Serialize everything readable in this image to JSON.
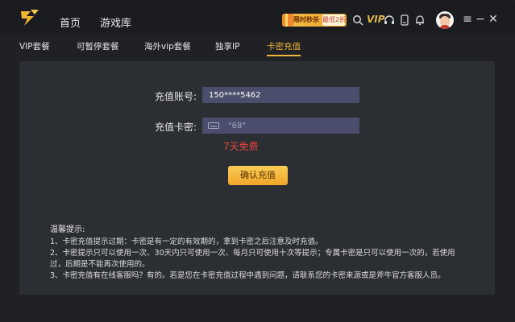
{
  "header": {
    "nav": [
      "首页",
      "游戏库"
    ],
    "promo": {
      "text": "限时秒杀",
      "badge": "最低2折"
    },
    "vip": "VIP",
    "colors": {
      "accent": "#f0b43c",
      "alert": "#e8453c"
    }
  },
  "tabs": [
    "VIP套餐",
    "可暂停套餐",
    "海外vip套餐",
    "独享IP",
    "卡密充值"
  ],
  "form": {
    "account_label": "充值账号:",
    "account_value": "150****5462",
    "card_label": "充值卡密:",
    "card_placeholder": "\"68\"",
    "free_text": "7天免费",
    "confirm_label": "确认充值"
  },
  "tips": {
    "title": "温馨提示:",
    "items": [
      "1、卡密充值提示过期：卡密是有一定的有效期的，拿到卡密之后注意及时充值。",
      "2、卡密提示只可以使用一次、30天内只可使用一次、每月只可使用十次等提示；专属卡密是只可以使用一次的，若使用过，后期是不能再次使用的。",
      "3、卡密充值有在线客服吗？有的。若是您在卡密充值过程中遇到问题，请联系您的卡密来源或是斧牛官方客服人员。"
    ]
  }
}
